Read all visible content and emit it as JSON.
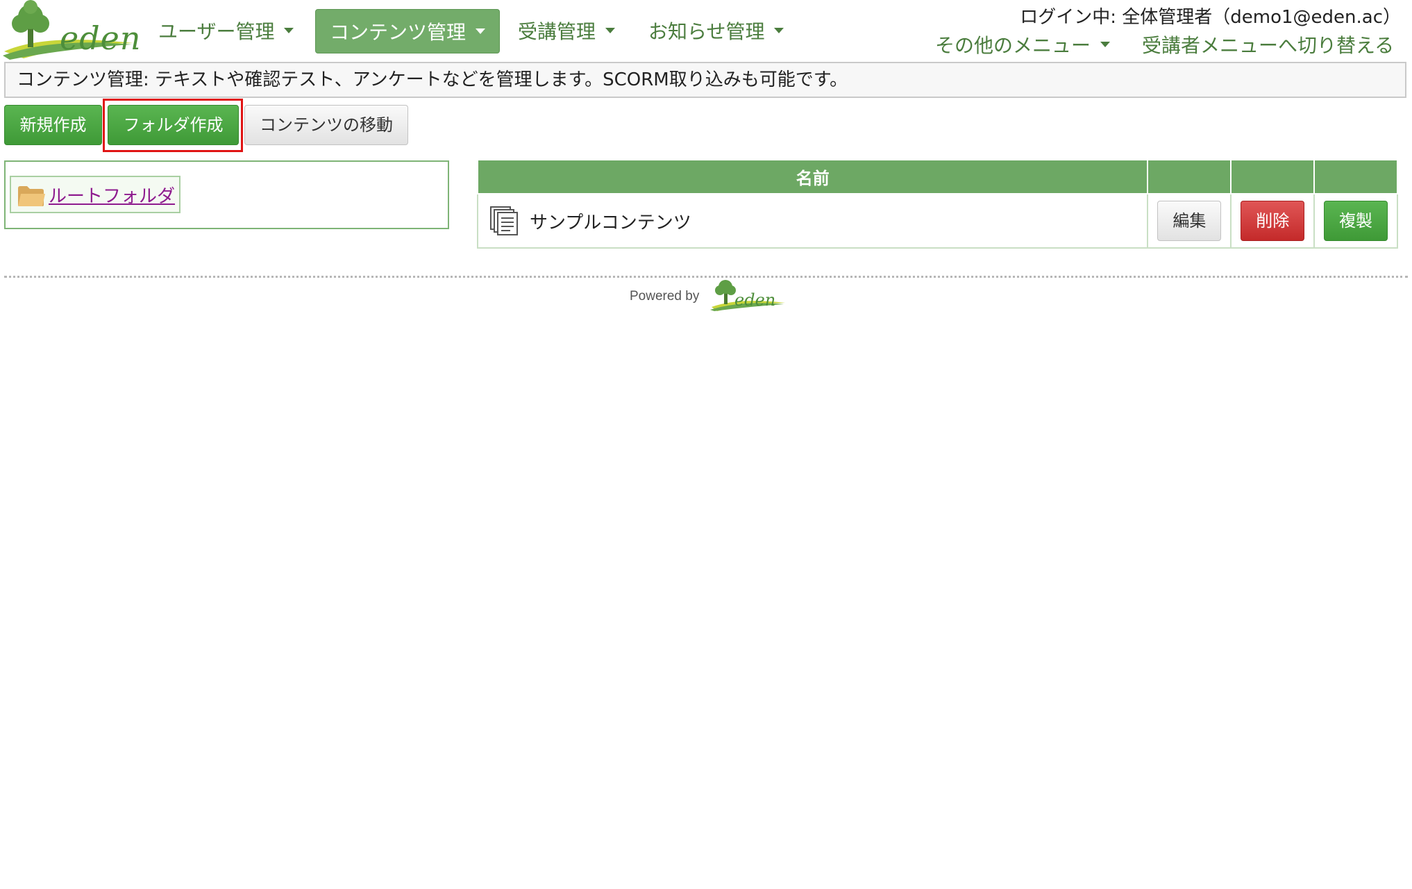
{
  "brand": {
    "logo_text": "eden",
    "accent": "#73ac6a",
    "dark_green": "#4b7d3e"
  },
  "nav": {
    "items": [
      {
        "label": "ユーザー管理",
        "active": false
      },
      {
        "label": "コンテンツ管理",
        "active": true
      },
      {
        "label": "受講管理",
        "active": false
      },
      {
        "label": "お知らせ管理",
        "active": false
      }
    ]
  },
  "header_right": {
    "login_status": "ログイン中: 全体管理者（demo1@eden.ac）",
    "other_menu": "その他のメニュー",
    "switch_link": "受講者メニューへ切り替える"
  },
  "description": "コンテンツ管理: テキストや確認テスト、アンケートなどを管理します。SCORM取り込みも可能です。",
  "toolbar": {
    "new_label": "新規作成",
    "folder_label": "フォルダ作成",
    "move_label": "コンテンツの移動"
  },
  "folder_tree": {
    "root_label": "ルートフォルダ",
    "icon": "folder-icon"
  },
  "table": {
    "header_name": "名前",
    "rows": [
      {
        "name": "サンプルコンテンツ",
        "icon": "document-stack-icon",
        "edit_label": "編集",
        "delete_label": "削除",
        "copy_label": "複製"
      }
    ]
  },
  "footer": {
    "powered_by": "Powered by",
    "logo_text": "eden"
  }
}
